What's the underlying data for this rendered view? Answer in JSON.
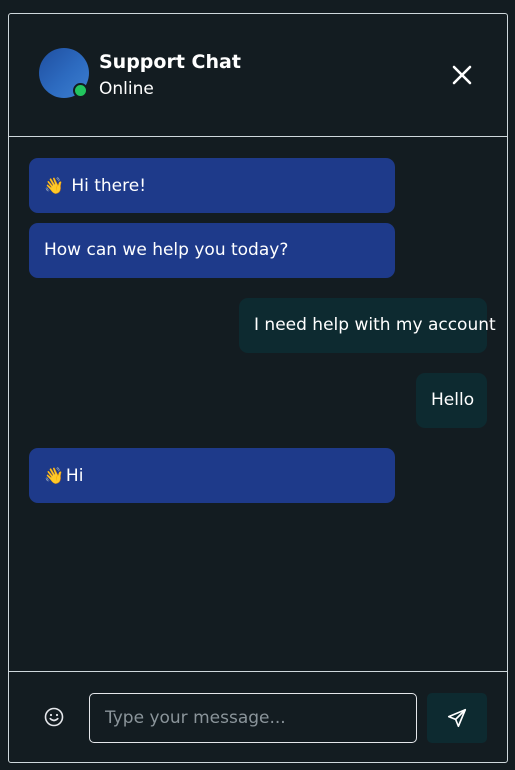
{
  "header": {
    "title": "Support Chat",
    "status": "Online",
    "close_icon": "close-icon",
    "avatar_color": "#2d6bc0",
    "status_color": "#22c55e"
  },
  "messages": [
    {
      "sender": "bot",
      "emoji": "👋",
      "text": "Hi there!"
    },
    {
      "sender": "bot",
      "text": "How can we help you today?"
    },
    {
      "sender": "user",
      "text": "I need help with my account"
    },
    {
      "sender": "user",
      "text": "Hello"
    },
    {
      "sender": "bot",
      "emoji": "👋",
      "text": "Hi"
    }
  ],
  "composer": {
    "placeholder": "Type your message...",
    "value": "",
    "emoji_icon": "smiley-icon",
    "send_icon": "send-icon"
  },
  "colors": {
    "background": "#131c21",
    "bot_bubble": "#1e3a8a",
    "user_bubble": "#0d2a30",
    "border": "#cfd8dc"
  }
}
